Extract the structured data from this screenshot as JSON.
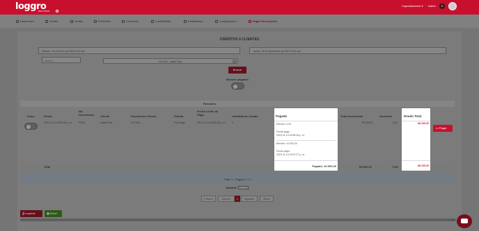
{
  "topbar": {
    "logo": "loggro",
    "logo_sub": "RESTOBAR",
    "capacitaciones": "Capacitaciones ▾",
    "user": "Isabel",
    "badge": "H"
  },
  "menu": [
    {
      "label": "Dashboard",
      "icon": "dashboard-icon"
    },
    {
      "label": "Vender",
      "icon": "cart-icon"
    },
    {
      "label": "Ventas",
      "icon": "receipt-icon"
    },
    {
      "label": "Productos",
      "icon": "box-icon"
    },
    {
      "label": "Domicilios",
      "icon": "bike-icon"
    },
    {
      "label": "Contabilidad",
      "icon": "ledger-icon"
    },
    {
      "label": "Estadísticas",
      "icon": "chart-icon"
    },
    {
      "label": "Configuración",
      "icon": "gear-icon"
    },
    {
      "label": "Pagar Suscripción",
      "icon": "card-icon",
      "active": true
    }
  ],
  "page": {
    "title": "CRÉDITOS A CLIENTES",
    "date_from": "Sábado, 30 de Enero de 2016 12:00 am",
    "date_to": "Jueves, 30 de Noviembre de 2023 12:00 am",
    "numero_placeholder": "Número",
    "client_select": "1117444 - Isabel Díaz",
    "buscar": "Buscar",
    "mostrar_pagados": "Mostrar pagados"
  },
  "table": {
    "resumen": "Resumen",
    "headers": {
      "todos": "Todos",
      "fecha": "Fecha",
      "no_doc": "No. Documento",
      "cliente": "Cliente",
      "doc_cliente": "Documento Cliente",
      "estado": "Estado",
      "fecha_limite": "Fecha Límite de Pago",
      "cantidad": "Cantidad de Cuotas",
      "total_doc": "Total Documento",
      "domicilio": "Domicilio"
    },
    "row": {
      "fecha": "2023-11-14 02:55:25 p. m.",
      "no_doc": "POS2",
      "cliente": "Isabel Díaz",
      "doc_cliente": "1117444",
      "estado": "Por Pagar",
      "fecha_limite": "2023-12-14 02:55:25 p. m.",
      "cantidad": "1",
      "total_doc": "$3.900,00",
      "domicilio": "0,00"
    },
    "total_label": "Total",
    "total_doc": "$3.900,00",
    "total_dom": "0,00"
  },
  "pagado_popup": {
    "title": "Pagado",
    "entries": [
      {
        "metodo": "Efectivo: 0,00",
        "fecha_label": "Fecha pago:",
        "fecha": "2023-11-14 02:55:26 p. m."
      },
      {
        "metodo": "Efectivo: 10.000,00",
        "fecha_label": "Fecha pago:",
        "fecha": "2023-11-14 02:57:27 p. m."
      }
    ],
    "total": "Pagado: 10.000,00"
  },
  "deuda_popup": {
    "title": "Deuda Total",
    "value": "-$6.100,00",
    "total": "-$6.100,00"
  },
  "pagar_button": "Pagar",
  "pager": {
    "info": "Total: 1 - Página: 1 / 1",
    "mostrar": "Mostrar:",
    "primero": "Primero",
    "anterior": "Anterior",
    "current": "1",
    "siguiente": "Siguiente",
    "ultimo": "Último"
  },
  "exports": {
    "imprimir": "Imprimir",
    "excel": "Excel"
  },
  "colors": {
    "brand_red": "#c8102e",
    "overlay_gray": "#757575"
  }
}
